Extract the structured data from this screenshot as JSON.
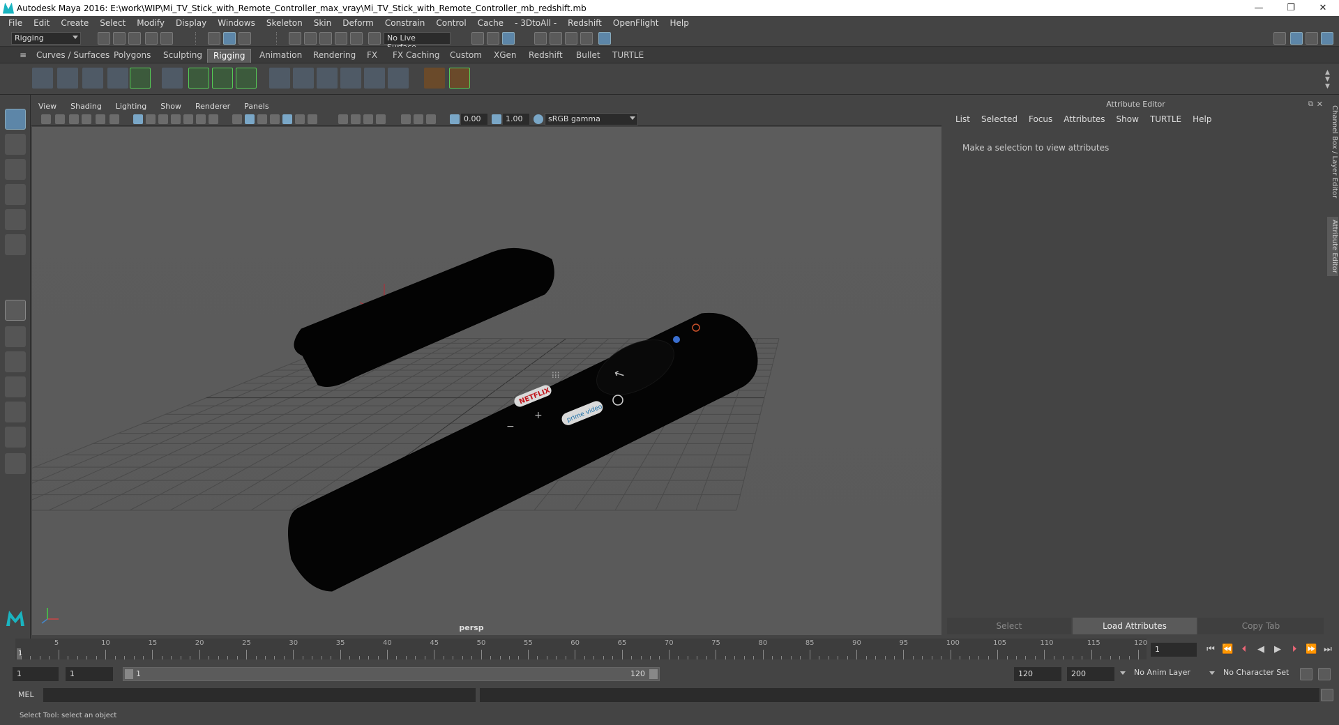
{
  "window": {
    "title": "Autodesk Maya 2016: E:\\work\\WIP\\Mi_TV_Stick_with_Remote_Controller_max_vray\\Mi_TV_Stick_with_Remote_Controller_mb_redshift.mb",
    "minimize": "—",
    "maximize": "❐",
    "close": "✕"
  },
  "menubar": [
    "File",
    "Edit",
    "Create",
    "Select",
    "Modify",
    "Display",
    "Windows",
    "Skeleton",
    "Skin",
    "Deform",
    "Constrain",
    "Control",
    "Cache",
    "- 3DtoAll -",
    "Redshift",
    "OpenFlight",
    "Help"
  ],
  "statusline": {
    "menuset": "Rigging",
    "live_surface": "No Live Surface"
  },
  "shelf": {
    "tabs": [
      "Curves / Surfaces",
      "Polygons",
      "Sculpting",
      "Rigging",
      "Animation",
      "Rendering",
      "FX",
      "FX Caching",
      "Custom",
      "XGen",
      "Redshift",
      "Bullet",
      "TURTLE"
    ],
    "active_tab": "Rigging"
  },
  "viewport": {
    "menus": [
      "View",
      "Shading",
      "Lighting",
      "Show",
      "Renderer",
      "Panels"
    ],
    "exposure": "0.00",
    "gamma": "1.00",
    "color_space": "sRGB gamma",
    "camera_label": "persp",
    "remote_labels": {
      "netflix": "NETFLIX",
      "prime": "prime video"
    }
  },
  "attribute_editor": {
    "title": "Attribute Editor",
    "menus": [
      "List",
      "Selected",
      "Focus",
      "Attributes",
      "Show",
      "TURTLE",
      "Help"
    ],
    "message": "Make a selection to view attributes",
    "buttons": {
      "select": "Select",
      "load": "Load Attributes",
      "copy_tab": "Copy Tab"
    },
    "side_tabs": {
      "channel_box": "Channel Box / Layer Editor",
      "attribute_editor": "Attribute Editor"
    }
  },
  "timeline": {
    "ticks": [
      "5",
      "10",
      "15",
      "20",
      "25",
      "30",
      "35",
      "40",
      "45",
      "50",
      "55",
      "60",
      "65",
      "70",
      "75",
      "80",
      "85",
      "90",
      "95",
      "100",
      "105",
      "110",
      "115",
      "120"
    ],
    "start_marker": "1",
    "current_frame": "1"
  },
  "range": {
    "start": "1",
    "playback_start": "1",
    "slider_start": "1",
    "slider_end": "120",
    "playback_end": "120",
    "end": "200",
    "anim_layer": "No Anim Layer",
    "character_set": "No Character Set"
  },
  "command_line": {
    "label": "MEL"
  },
  "help_line": "Select Tool: select an object"
}
